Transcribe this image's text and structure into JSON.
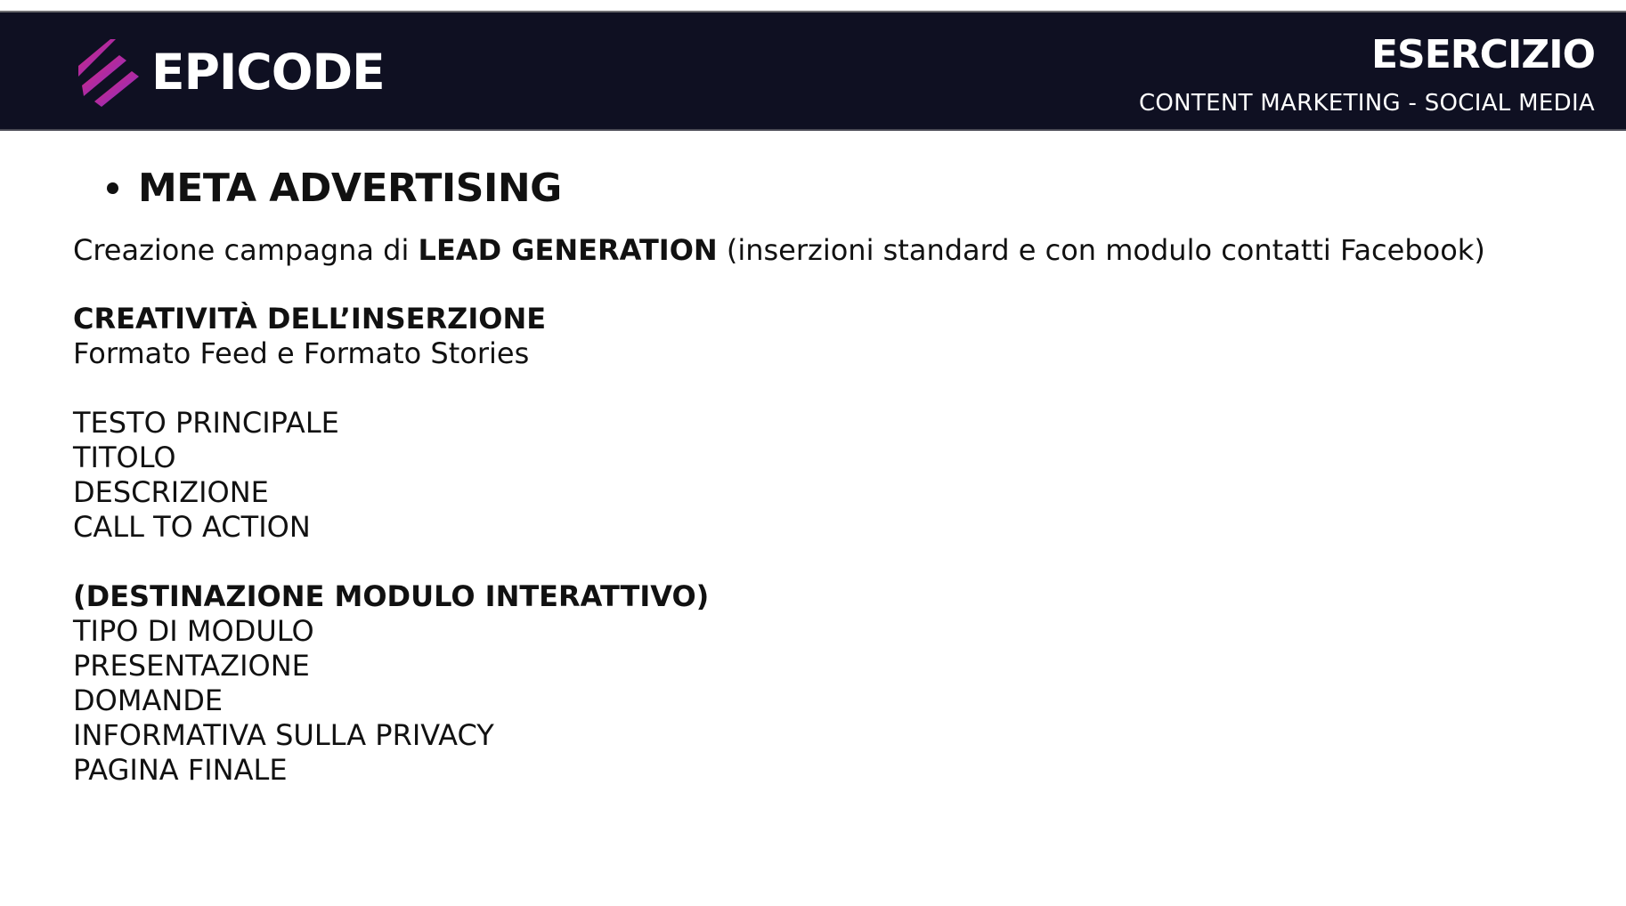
{
  "header": {
    "brand": "EPICODE",
    "logo_icon": "epicode-stripes-icon",
    "title": "ESERCIZIO",
    "subtitle": "CONTENT MARKETING - SOCIAL MEDIA",
    "background": "#0f1022",
    "brand_gradient": [
      "#e0266f",
      "#7c2fd6"
    ]
  },
  "slide": {
    "heading": "META ADVERTISING",
    "intro": {
      "prefix": "Creazione campagna di ",
      "emphasis": "LEAD GENERATION",
      "suffix": " (inserzioni standard e con modulo contatti Facebook)"
    },
    "creative_section": {
      "title": "CREATIVITÀ DELL’INSERZIONE",
      "subtitle": "Formato Feed e Formato Stories"
    },
    "creative_items": [
      "TESTO PRINCIPALE",
      "TITOLO",
      "DESCRIZIONE",
      "CALL TO ACTION"
    ],
    "form_section": {
      "title": "(DESTINAZIONE MODULO INTERATTIVO)"
    },
    "form_items": [
      "TIPO DI MODULO",
      "PRESENTAZIONE",
      "DOMANDE",
      "INFORMATIVA SULLA PRIVACY",
      "PAGINA FINALE"
    ]
  }
}
